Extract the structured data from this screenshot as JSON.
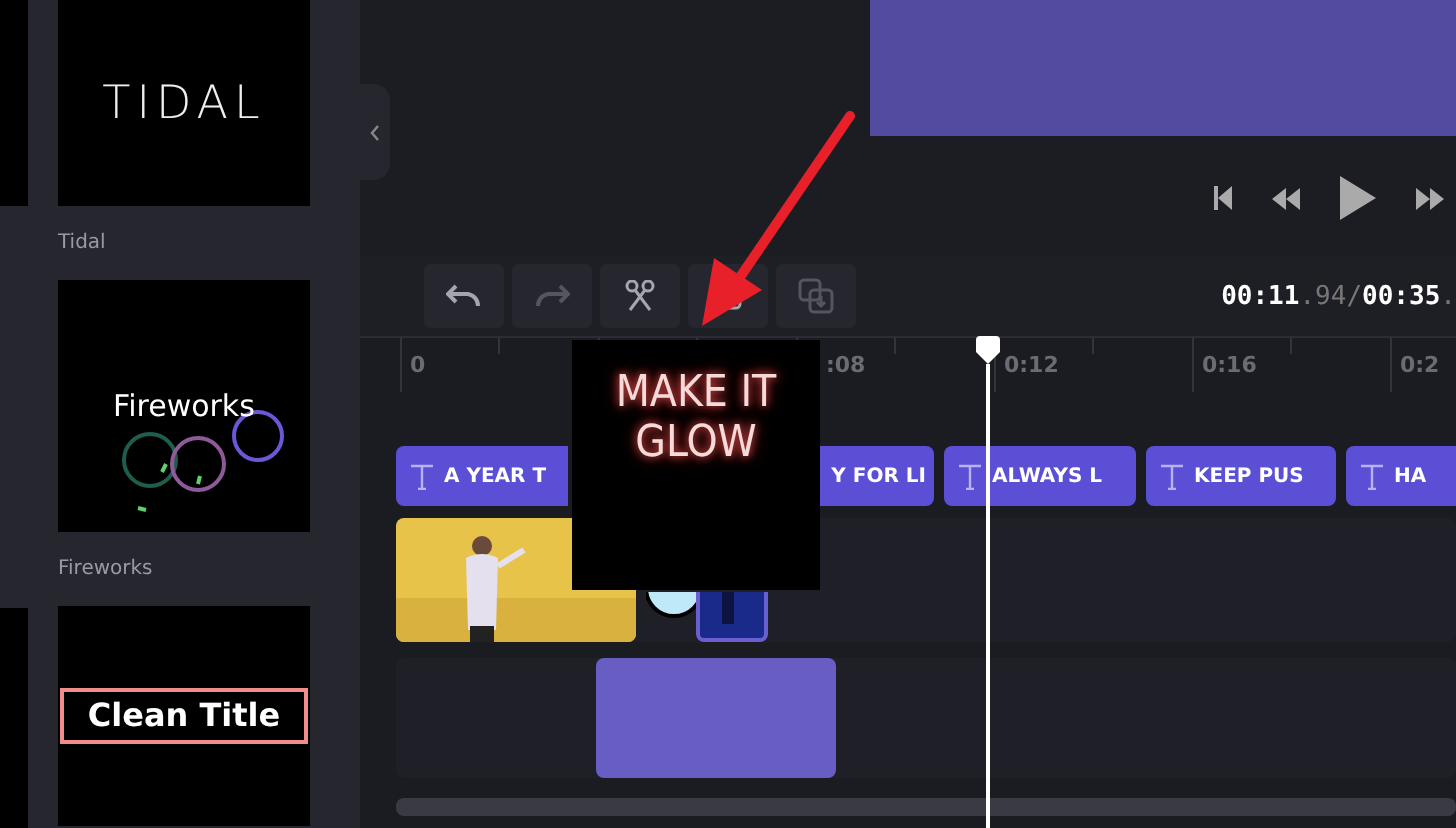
{
  "sidebar": {
    "templates": [
      {
        "preview_text": "TIDAL",
        "kind": "tidal",
        "label": "Tidal"
      },
      {
        "preview_text": "Fireworks",
        "kind": "fireworks",
        "label": "Fireworks"
      },
      {
        "preview_text": "Clean Title",
        "kind": "clean"
      }
    ]
  },
  "toolbar": {
    "buttons": [
      {
        "disabled": false
      },
      {
        "disabled": true
      },
      {
        "disabled": false
      },
      {
        "disabled": false
      },
      {
        "disabled": true
      }
    ],
    "time": {
      "current": "00:11",
      "current_fraction": ".94",
      "separator": "/",
      "total": "00:35",
      "total_fraction": "."
    }
  },
  "ruler": {
    "labels": [
      "0",
      ":08",
      "0:12",
      "0:16",
      "0:2"
    ]
  },
  "text_track": {
    "clips": [
      {
        "text": "A YEAR T"
      },
      {
        "text": "Y FOR LI"
      },
      {
        "text": "ALWAYS L"
      },
      {
        "text": "KEEP PUS"
      },
      {
        "text": "HA"
      }
    ]
  },
  "drag_preview": {
    "text": "MAKE IT GLOW"
  }
}
